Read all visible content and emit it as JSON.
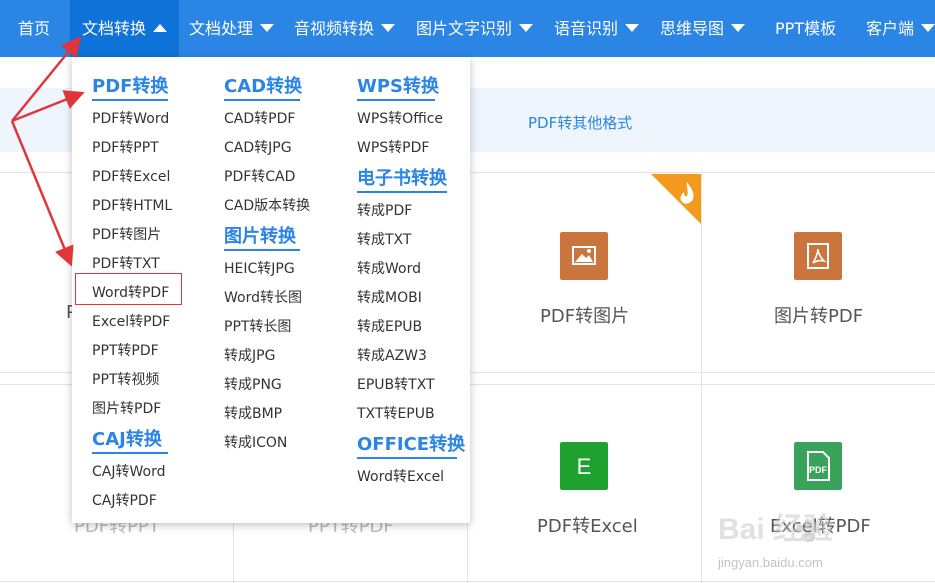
{
  "nav": {
    "items": [
      {
        "label": "首页"
      },
      {
        "label": "文档转换"
      },
      {
        "label": "文档处理"
      },
      {
        "label": "音视频转换"
      },
      {
        "label": "图片文字识别"
      },
      {
        "label": "语音识别"
      },
      {
        "label": "思维导图"
      },
      {
        "label": "PPT模板"
      },
      {
        "label": "客户端"
      }
    ]
  },
  "subbar": {
    "label": "PDF转其他格式"
  },
  "cards": {
    "row1": [
      {
        "label": "PDF转图片",
        "icon": "image-icon",
        "color": "#c9753d"
      },
      {
        "label": "图片转PDF",
        "icon": "pdf-icon",
        "color": "#c9753d"
      }
    ],
    "row2": [
      {
        "label": "PDF转Excel",
        "icon": "excel-icon",
        "color": "#1ea12f",
        "glyph": "E"
      },
      {
        "label": "Excel转PDF",
        "icon": "pdf-file-icon",
        "color": "#3aa35a",
        "glyph": "PDF"
      }
    ],
    "hidden_left_row1": "P",
    "hidden_row2": [
      "PDF转PPT",
      "PPT转PDF"
    ]
  },
  "dropdown": {
    "col1": {
      "head": "PDF转换",
      "items": [
        "PDF转Word",
        "PDF转PPT",
        "PDF转Excel",
        "PDF转HTML",
        "PDF转图片",
        "PDF转TXT",
        "Word转PDF",
        "Excel转PDF",
        "PPT转PDF",
        "PPT转视频",
        "图片转PDF"
      ],
      "head2": "CAJ转换",
      "items2": [
        "CAJ转Word",
        "CAJ转PDF"
      ]
    },
    "col2": {
      "head": "CAD转换",
      "items": [
        "CAD转PDF",
        "CAD转JPG",
        "PDF转CAD",
        "CAD版本转换"
      ],
      "head2": "图片转换",
      "items2": [
        "HEIC转JPG",
        "Word转长图",
        "PPT转长图",
        "转成JPG",
        "转成PNG",
        "转成BMP",
        "转成ICON"
      ]
    },
    "col3": {
      "head": "WPS转换",
      "items": [
        "WPS转Office",
        "WPS转PDF"
      ],
      "head2": "电子书转换",
      "items2": [
        "转成PDF",
        "转成TXT",
        "转成Word",
        "转成MOBI",
        "转成EPUB",
        "转成AZW3",
        "EPUB转TXT",
        "TXT转EPUB"
      ],
      "head3": "OFFICE转换",
      "items3": [
        "Word转Excel"
      ]
    }
  },
  "watermark": {
    "text": "Bai 经验",
    "url": "jingyan.baidu.com"
  },
  "colors": {
    "nav": "#2b85e4",
    "accent": "#2b85e4",
    "annotation": "#e0363b"
  }
}
